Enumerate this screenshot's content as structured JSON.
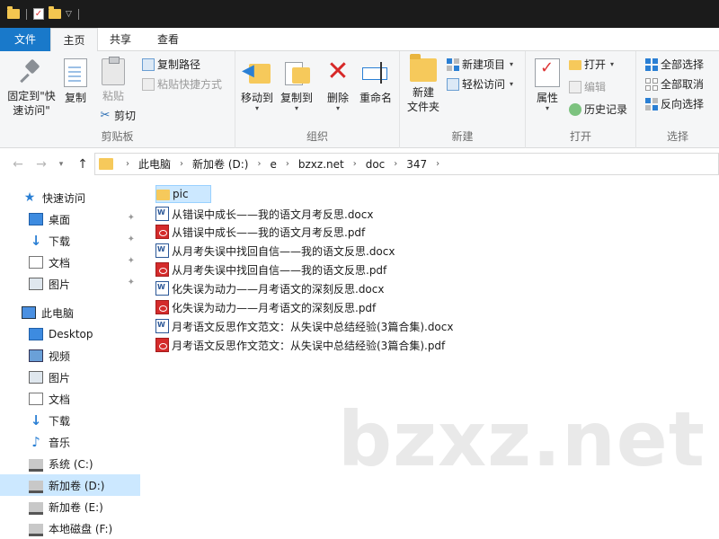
{
  "ribbon_tabs": {
    "file": "文件",
    "home": "主页",
    "share": "共享",
    "view": "查看"
  },
  "clipboard": {
    "pin_label_1": "固定到\"快",
    "pin_label_2": "速访问\"",
    "copy": "复制",
    "paste": "粘贴",
    "copy_path": "复制路径",
    "paste_shortcut": "粘贴快捷方式",
    "cut": "剪切",
    "group": "剪贴板"
  },
  "organize": {
    "move_to": "移动到",
    "copy_to": "复制到",
    "delete": "删除",
    "rename": "重命名",
    "group": "组织"
  },
  "new": {
    "new_folder_1": "新建",
    "new_folder_2": "文件夹",
    "new_item": "新建项目",
    "easy_access": "轻松访问",
    "group": "新建"
  },
  "open": {
    "properties": "属性",
    "open": "打开",
    "edit": "编辑",
    "history": "历史记录",
    "group": "打开"
  },
  "select": {
    "select_all": "全部选择",
    "select_none": "全部取消",
    "invert": "反向选择",
    "group": "选择"
  },
  "address": {
    "crumbs": [
      "此电脑",
      "新加卷 (D:)",
      "e",
      "bzxz.net",
      "doc",
      "347"
    ]
  },
  "nav": {
    "quick_access": "快速访问",
    "qa_desktop": "桌面",
    "qa_downloads": "下载",
    "qa_documents": "文档",
    "qa_pictures": "图片",
    "this_pc": "此电脑",
    "pc_desktop": "Desktop",
    "pc_videos": "视频",
    "pc_pictures": "图片",
    "pc_documents": "文档",
    "pc_downloads": "下载",
    "pc_music": "音乐",
    "drive_c": "系统 (C:)",
    "drive_d": "新加卷 (D:)",
    "drive_e": "新加卷 (E:)",
    "drive_f": "本地磁盘 (F:)"
  },
  "files": [
    "pic",
    "从错误中成长——我的语文月考反思.docx",
    "从错误中成长——我的语文月考反思.pdf",
    "从月考失误中找回自信——我的语文反思.docx",
    "从月考失误中找回自信——我的语文反思.pdf",
    "化失误为动力——月考语文的深刻反思.docx",
    "化失误为动力——月考语文的深刻反思.pdf",
    "月考语文反思作文范文：从失误中总结经验(3篇合集).docx",
    "月考语文反思作文范文：从失误中总结经验(3篇合集).pdf"
  ],
  "watermark": "bzxz.net",
  "colors": {
    "accent": "#1979ca",
    "selection": "#cce8ff",
    "folder": "#f6c95b",
    "pdf": "#d42b2b"
  }
}
